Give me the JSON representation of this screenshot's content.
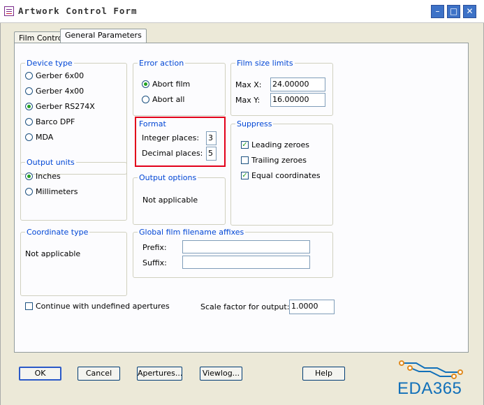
{
  "window": {
    "title": "Artwork Control Form"
  },
  "tabs": {
    "film_control": "Film Control",
    "general_parameters": "General Parameters"
  },
  "device_type": {
    "title": "Device type",
    "options": [
      "Gerber 6x00",
      "Gerber 4x00",
      "Gerber RS274X",
      "Barco DPF",
      "MDA"
    ],
    "selected": "Gerber RS274X"
  },
  "output_units": {
    "title": "Output units",
    "options": [
      "Inches",
      "Millimeters"
    ],
    "selected": "Inches"
  },
  "coordinate_type": {
    "title": "Coordinate type",
    "value": "Not applicable"
  },
  "error_action": {
    "title": "Error action",
    "options": [
      "Abort film",
      "Abort all"
    ],
    "selected": "Abort film"
  },
  "format": {
    "title": "Format",
    "integer_label": "Integer places:",
    "integer_value": "3",
    "decimal_label": "Decimal places:",
    "decimal_value": "5"
  },
  "output_options": {
    "title": "Output options",
    "value": "Not applicable"
  },
  "film_size_limits": {
    "title": "Film size limits",
    "maxx_label": "Max X:",
    "maxx_value": "24.00000",
    "maxy_label": "Max Y:",
    "maxy_value": "16.00000"
  },
  "suppress": {
    "title": "Suppress",
    "leading": {
      "label": "Leading zeroes",
      "checked": true
    },
    "trailing": {
      "label": "Trailing zeroes",
      "checked": false
    },
    "equal": {
      "label": "Equal coordinates",
      "checked": true
    }
  },
  "affixes": {
    "title": "Global film filename affixes",
    "prefix_label": "Prefix:",
    "prefix_value": "",
    "suffix_label": "Suffix:",
    "suffix_value": ""
  },
  "continue_undefined": {
    "label": "Continue with undefined apertures",
    "checked": false
  },
  "scale": {
    "label": "Scale factor for output:",
    "value": "1.0000"
  },
  "buttons": {
    "ok": "OK",
    "cancel": "Cancel",
    "apertures": "Apertures...",
    "viewlog": "Viewlog...",
    "help": "Help"
  },
  "watermark": {
    "text": "EDA365"
  }
}
